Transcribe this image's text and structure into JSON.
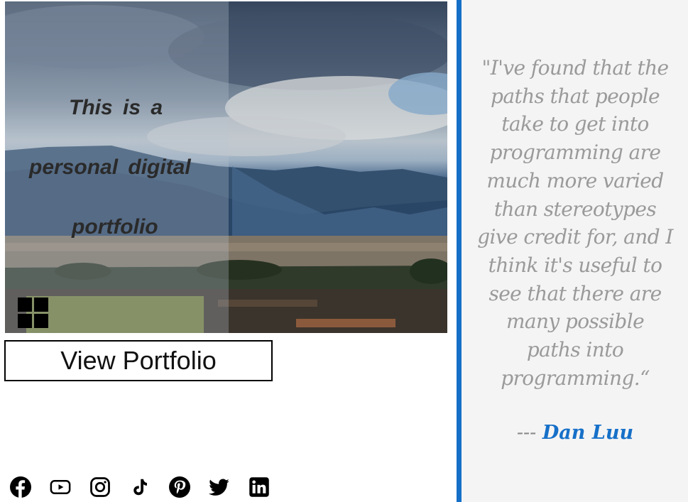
{
  "hero": {
    "tagline_lines": [
      "This  is a",
      "personal  digital",
      "portfolio"
    ]
  },
  "view_button": {
    "label": "View Portfolio"
  },
  "social_icons": [
    "facebook-icon",
    "youtube-icon",
    "instagram-icon",
    "tiktok-icon",
    "pinterest-icon",
    "twitter-icon",
    "linkedin-icon"
  ],
  "quote": {
    "lines": [
      "\"I've found that the",
      "paths that people",
      "take to get into",
      "programming are",
      "much more varied",
      "than stereotypes",
      "give credit for, and I",
      "think it's useful to",
      "see that there are",
      "many possible",
      "paths into",
      "programming.“"
    ],
    "dash": "---",
    "author": "Dan Luu"
  },
  "colors": {
    "accent": "#1670c8",
    "quote_text": "#9a9a9a",
    "panel_bg": "#f5f4f4"
  }
}
